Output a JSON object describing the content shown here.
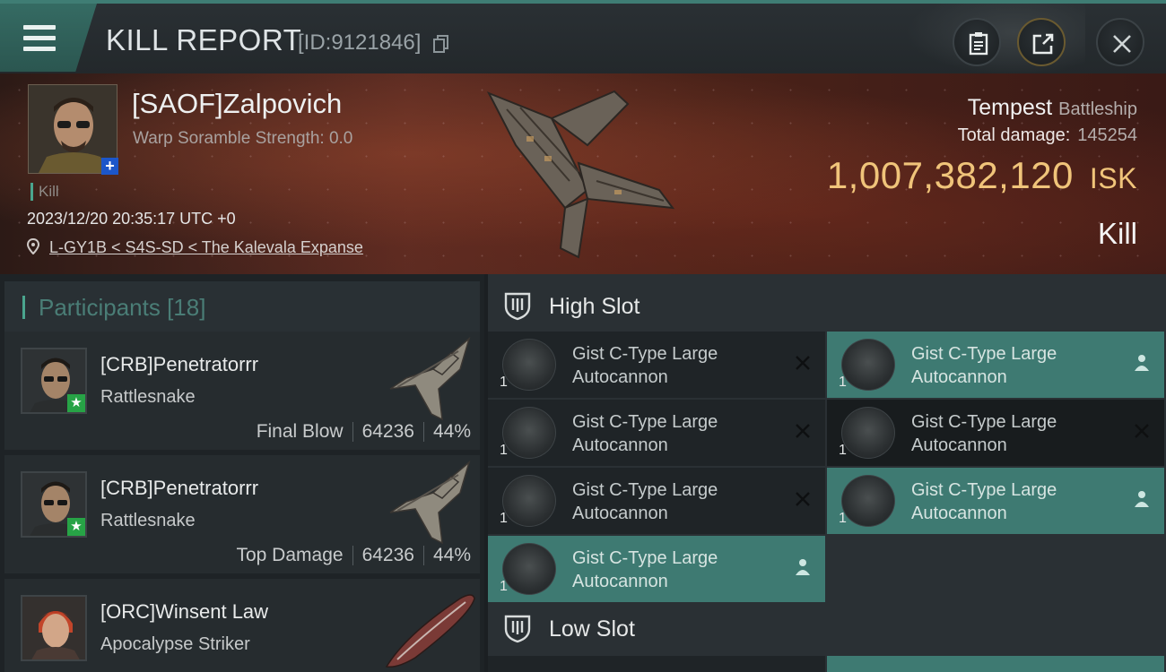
{
  "header": {
    "title": "KILL REPORT",
    "report_id": "[ID:9121846]"
  },
  "victim": {
    "name": "[SAOF]Zalpovich",
    "warp_scramble": "Warp Soramble Strength: 0.0",
    "kill_tag": "Kill",
    "datetime": "2023/12/20 20:35:17 UTC +0",
    "location": "L-GY1B < S4S-SD < The Kalevala Expanse",
    "ship": "Tempest",
    "ship_class": "Battleship",
    "total_damage_label": "Total damage:",
    "total_damage": "145254",
    "isk_value": "1,007,382,120",
    "isk_unit": "ISK",
    "result": "Kill"
  },
  "participants": {
    "title": "Participants",
    "count": "[18]",
    "rows": [
      {
        "name": "[CRB]Penetratorrr",
        "ship": "Rattlesnake",
        "role": "Final Blow",
        "damage": "64236",
        "percent": "44%"
      },
      {
        "name": "[CRB]Penetratorrr",
        "ship": "Rattlesnake",
        "role": "Top Damage",
        "damage": "64236",
        "percent": "44%"
      },
      {
        "name": "[ORC]Winsent Law",
        "ship": "Apocalypse Striker",
        "role": "",
        "damage": "",
        "percent": ""
      }
    ]
  },
  "fitting": {
    "high_slot_label": "High Slot",
    "low_slot_label": "Low Slot",
    "high_modules": [
      {
        "line1": "Gist C-Type Large",
        "line2": "Autocannon",
        "qty": "1",
        "status": "destroyed"
      },
      {
        "line1": "Gist C-Type Large",
        "line2": "Autocannon",
        "qty": "1",
        "status": "dropped"
      },
      {
        "line1": "Gist C-Type Large",
        "line2": "Autocannon",
        "qty": "1",
        "status": "destroyed"
      },
      {
        "line1": "Gist C-Type Large",
        "line2": "Autocannon",
        "qty": "1",
        "status": "destroyed"
      },
      {
        "line1": "Gist C-Type Large",
        "line2": "Autocannon",
        "qty": "1",
        "status": "destroyed"
      },
      {
        "line1": "Gist C-Type Large",
        "line2": "Autocannon",
        "qty": "1",
        "status": "dropped"
      },
      {
        "line1": "Gist C-Type Large",
        "line2": "Autocannon",
        "qty": "1",
        "status": "dropped"
      }
    ]
  },
  "colors": {
    "accent": "#3e7a72",
    "isk": "#f0c47a",
    "banner": "#5a2b22"
  }
}
